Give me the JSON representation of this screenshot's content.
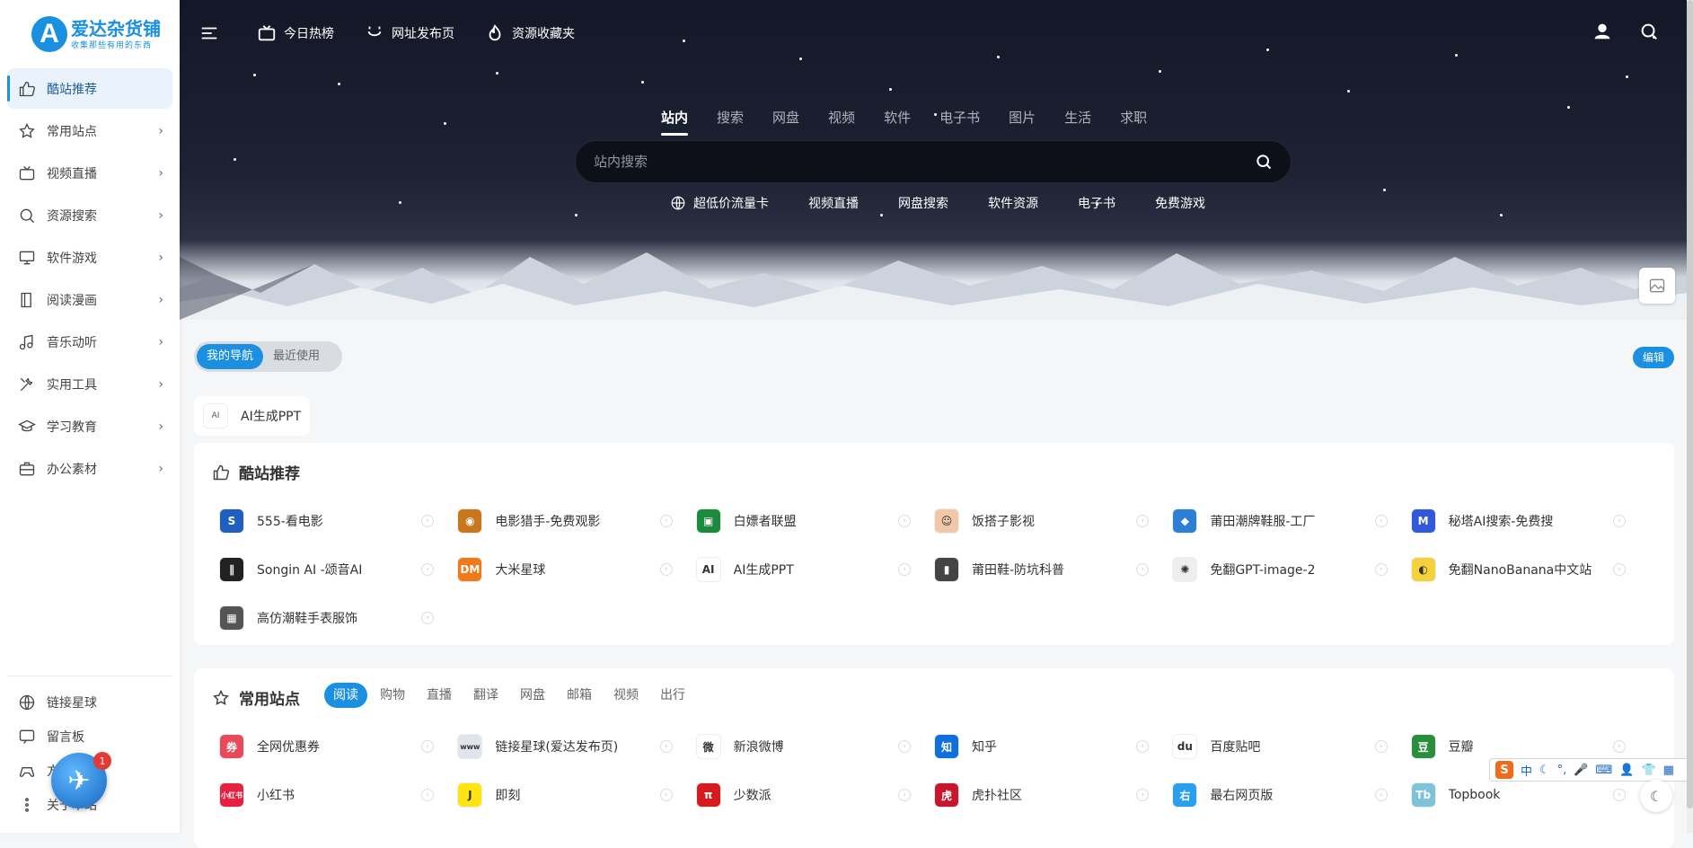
{
  "logo": {
    "mark": "A",
    "name": "爱达杂货铺",
    "tagline": "收集那些有用的东西"
  },
  "sidebar": {
    "items": [
      {
        "label": "酷站推荐",
        "icon": "thumbs-up-icon",
        "active": true
      },
      {
        "label": "常用站点",
        "icon": "star-icon"
      },
      {
        "label": "视频直播",
        "icon": "tv-icon"
      },
      {
        "label": "资源搜索",
        "icon": "search-icon"
      },
      {
        "label": "软件游戏",
        "icon": "monitor-icon"
      },
      {
        "label": "阅读漫画",
        "icon": "book-icon"
      },
      {
        "label": "音乐动听",
        "icon": "music-icon"
      },
      {
        "label": "实用工具",
        "icon": "tools-icon"
      },
      {
        "label": "学习教育",
        "icon": "graduation-icon"
      },
      {
        "label": "办公素材",
        "icon": "briefcase-icon"
      }
    ],
    "bottom": [
      {
        "label": "链接星球",
        "icon": "globe-icon"
      },
      {
        "label": "留言板",
        "icon": "message-icon"
      },
      {
        "label": "方",
        "icon": "gamepad-icon"
      },
      {
        "label": "关于本站",
        "icon": "more-icon"
      }
    ],
    "badge": "1"
  },
  "topbar": {
    "links": [
      {
        "label": "今日热榜",
        "icon": "tv-icon"
      },
      {
        "label": "网址发布页",
        "icon": "smile-icon"
      },
      {
        "label": "资源收藏夹",
        "icon": "fire-icon"
      }
    ]
  },
  "search": {
    "tabs": [
      "站内",
      "搜索",
      "网盘",
      "视频",
      "软件",
      "电子书",
      "图片",
      "生活",
      "求职"
    ],
    "placeholder": "站内搜索",
    "quick_links": [
      "超低价流量卡",
      "视频直播",
      "网盘搜索",
      "软件资源",
      "电子书",
      "免费游戏"
    ]
  },
  "mynav": {
    "tabs": [
      "我的导航",
      "最近使用"
    ],
    "edit": "编辑",
    "items": [
      "AI生成PPT"
    ]
  },
  "cool": {
    "title": "酷站推荐",
    "sites": [
      {
        "name": "555-看电影",
        "color": "#1f5fbf",
        "glyph": "S"
      },
      {
        "name": "电影猎手-免费观影",
        "color": "#c8771f",
        "glyph": "◉"
      },
      {
        "name": "白嫖者联盟",
        "color": "#1b8a3c",
        "glyph": "▣"
      },
      {
        "name": "饭搭子影视",
        "color": "#f0c7a8",
        "glyph": "☺"
      },
      {
        "name": "莆田潮牌鞋服-工厂",
        "color": "#2b7fd4",
        "glyph": "◆"
      },
      {
        "name": "秘塔AI搜索-免费搜",
        "color": "#3259d9",
        "glyph": "M"
      },
      {
        "name": "Songin AI -颂音AI",
        "color": "#222",
        "glyph": "∥"
      },
      {
        "name": "大米星球",
        "color": "#f07a1a",
        "glyph": "DM"
      },
      {
        "name": "AI生成PPT",
        "color": "#ffffff",
        "glyph": "AI"
      },
      {
        "name": "莆田鞋-防坑科普",
        "color": "#444",
        "glyph": "▮"
      },
      {
        "name": "免翻GPT-image-2",
        "color": "#eeeeee",
        "glyph": "✺"
      },
      {
        "name": "免翻NanoBanana中文站",
        "color": "#f5d23c",
        "glyph": "◐"
      },
      {
        "name": "高仿潮鞋手表服饰",
        "color": "#555",
        "glyph": "▦"
      }
    ]
  },
  "common": {
    "title": "常用站点",
    "tabs": [
      "阅读",
      "购物",
      "直播",
      "翻译",
      "网盘",
      "邮箱",
      "视频",
      "出行"
    ],
    "sites": [
      {
        "name": "全网优惠券",
        "color": "#e94a5a",
        "glyph": "券"
      },
      {
        "name": "链接星球(爱达发布页)",
        "color": "#dfe5ea",
        "glyph": "www"
      },
      {
        "name": "新浪微博",
        "color": "#ffffff",
        "glyph": "微"
      },
      {
        "name": "知乎",
        "color": "#0f6fde",
        "glyph": "知"
      },
      {
        "name": "百度贴吧",
        "color": "#ffffff",
        "glyph": "du"
      },
      {
        "name": "豆瓣",
        "color": "#2a8f3c",
        "glyph": "豆"
      },
      {
        "name": "小红书",
        "color": "#e6213f",
        "glyph": "小红书"
      },
      {
        "name": "即刻",
        "color": "#ffe411",
        "glyph": "J"
      },
      {
        "name": "少数派",
        "color": "#d71a1b",
        "glyph": "π"
      },
      {
        "name": "虎扑社区",
        "color": "#c8162c",
        "glyph": "虎"
      },
      {
        "name": "最右网页版",
        "color": "#2a9ff0",
        "glyph": "右"
      },
      {
        "name": "Topbook",
        "color": "#7ec3d9",
        "glyph": "Tb"
      }
    ]
  },
  "ime": {
    "items": [
      "中",
      "☾",
      "°,",
      "🎤",
      "⌨",
      "👤",
      "👕",
      "▦"
    ]
  }
}
